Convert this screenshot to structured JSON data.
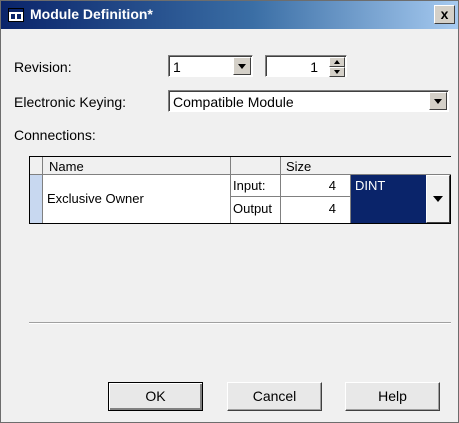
{
  "window": {
    "title": "Module Definition*",
    "close_label": "x",
    "colors": {
      "titlebar": "#0a246a",
      "selection": "#0a246a",
      "face": "#f0f0f0"
    }
  },
  "revision": {
    "label": "Revision:",
    "major": "1",
    "minor": "1"
  },
  "keying": {
    "label": "Electronic Keying:",
    "value": "Compatible Module"
  },
  "connections": {
    "label": "Connections:",
    "headers": {
      "name": "Name",
      "blank": "",
      "size": "Size"
    },
    "rows": [
      {
        "name": "Exclusive Owner",
        "input_label": "Input:",
        "input_size": "4",
        "output_label": "Output",
        "output_size": "4",
        "data_type": "DINT"
      }
    ]
  },
  "buttons": {
    "ok": "OK",
    "cancel": "Cancel",
    "help": "Help"
  },
  "icons": {
    "title": "module-window-icon",
    "dropdown": "chevron-down-icon",
    "spin": "spin-arrows-icon"
  }
}
